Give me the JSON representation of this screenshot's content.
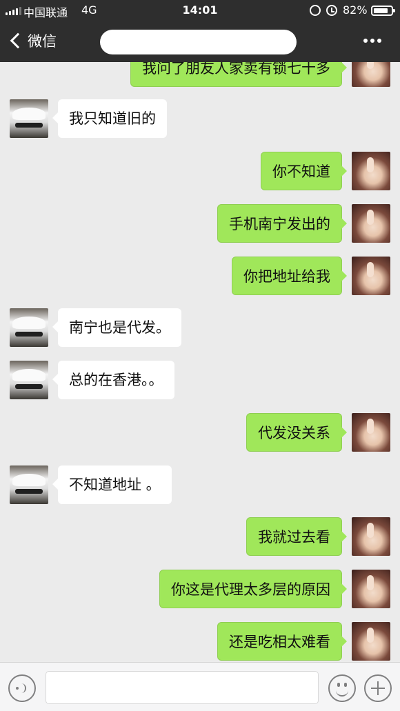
{
  "status_bar": {
    "carrier": "中国联通",
    "network": "4G",
    "time": "14:01",
    "battery": "82%",
    "battery_level": 0.82,
    "signal_bars": 4
  },
  "nav": {
    "back_label": "微信",
    "chat_title": "",
    "more_icon": "more-dots-icon"
  },
  "messages": [
    {
      "side": "right",
      "text": "我问了朋友人家卖有锁七十多"
    },
    {
      "side": "left",
      "text": "我只知道旧的"
    },
    {
      "side": "right",
      "text": "你不知道"
    },
    {
      "side": "right",
      "text": "手机南宁发出的"
    },
    {
      "side": "right",
      "text": "你把地址给我"
    },
    {
      "side": "left",
      "text": "南宁也是代发。"
    },
    {
      "side": "left",
      "text": "总的在香港。。"
    },
    {
      "side": "right",
      "text": "代发没关系"
    },
    {
      "side": "left",
      "text": "不知道地址 。"
    },
    {
      "side": "right",
      "text": "我就过去看"
    },
    {
      "side": "right",
      "text": "你这是代理太多层的原因"
    },
    {
      "side": "right",
      "text": "还是吃相太难看"
    }
  ],
  "input_bar": {
    "text": "",
    "icons": [
      "voice-icon",
      "emoji-icon",
      "plus-icon"
    ]
  },
  "colors": {
    "header_bg": "#2e2e2e",
    "chat_bg": "#ebebeb",
    "sent_bubble": "#a0e75a",
    "received_bubble": "#ffffff"
  }
}
